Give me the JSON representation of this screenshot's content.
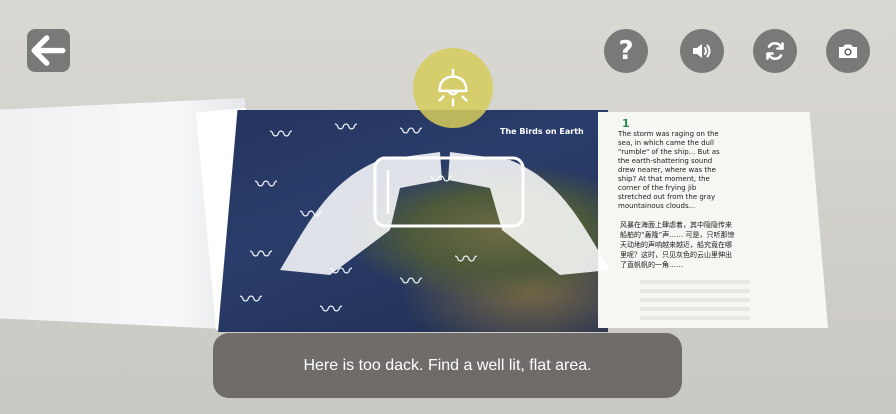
{
  "toolbar": {
    "back_icon": "arrow-left-icon",
    "help_label": "?",
    "help_icon": "question-icon",
    "sound_icon": "speaker-icon",
    "refresh_icon": "refresh-icon",
    "camera_icon": "camera-icon"
  },
  "indicator": {
    "icon": "lamp-icon",
    "color": "#d6cc5c"
  },
  "book": {
    "map_title": "The Birds on Earth",
    "page_number": "1",
    "english_text": "The storm was raging on the sea, in which came the dull \"rumble\" of the ship... But as the earth-shattering sound drew nearer, where was the ship? At that moment, the corner of the frying jib stretched out from the gray mountainous clouds...",
    "chinese_text": "风暴在海面上肆虐着，其中隐隐传来船舶的“轰隆”声…… 可是，只听那惊天动地的声响越来越近，船究竟在哪里呢？这时，只见灰色的云山里伸出了直帆帆的一角……"
  },
  "message": {
    "text": "Here is too dack. Find a well lit, flat area."
  }
}
